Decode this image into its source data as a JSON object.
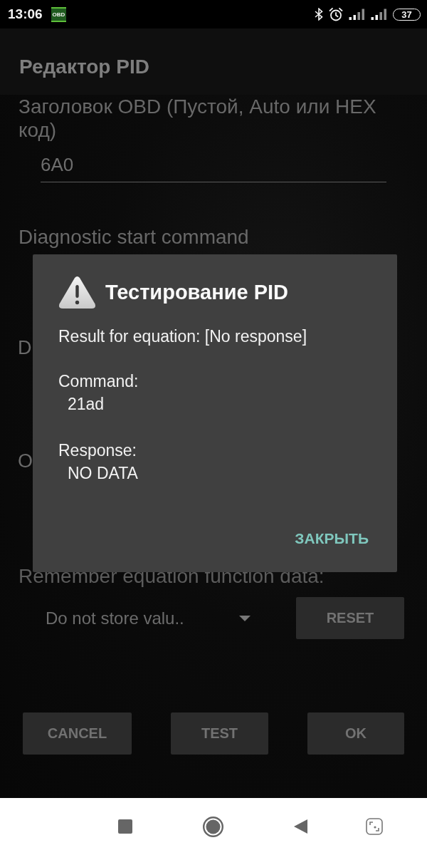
{
  "status_bar": {
    "time": "13:06",
    "notification_badge": "OBD",
    "battery": "37"
  },
  "app_bar": {
    "title": "Редактор PID"
  },
  "form": {
    "header_label": "Заголовок OBD (Пустой, Auto или HEX код)",
    "header_value": "6A0",
    "start_command_label": "Diagnostic start command",
    "covered_labels": [
      "D",
      "O"
    ],
    "remember_label": "Remember equation function data:",
    "remember_option": "Do not store valu..",
    "reset_button": "RESET"
  },
  "buttons": [
    "CANCEL",
    "TEST",
    "OK"
  ],
  "dialog": {
    "title": "Тестирование PID",
    "result": "Result for equation: [No response]",
    "fields": [
      {
        "label": "Command:",
        "value": "21ad"
      },
      {
        "label": "Response:",
        "value": "NO DATA"
      }
    ],
    "close_button": "ЗАКРЫТЬ"
  }
}
